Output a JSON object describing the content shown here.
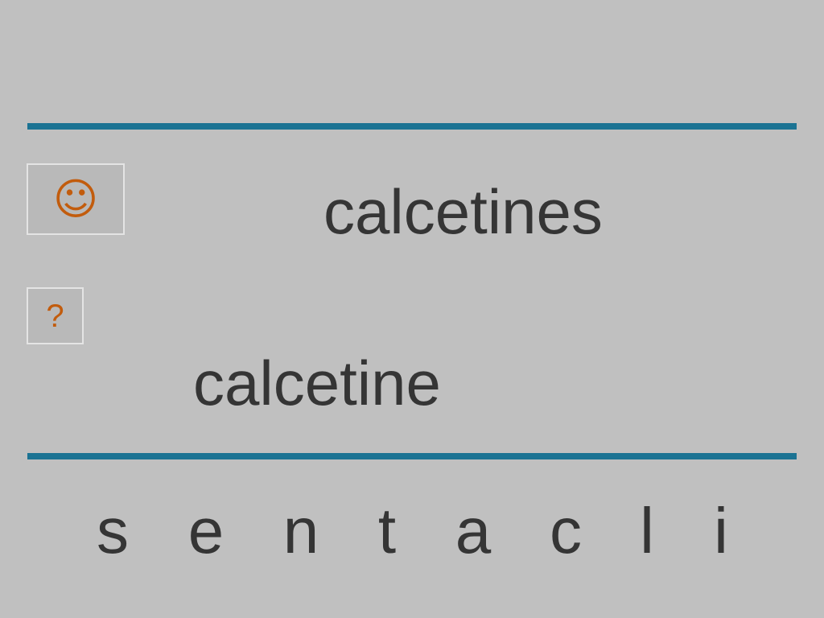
{
  "buttons": {
    "smiley_icon": "☺",
    "hint_label": "?"
  },
  "target_word": "calcetines",
  "answer_word": "calcetine",
  "letters": [
    "s",
    "e",
    "n",
    "t",
    "a",
    "c",
    "l",
    "i"
  ],
  "colors": {
    "background": "#c0c0c0",
    "rule": "#1b7393",
    "text": "#353535",
    "icon": "#c25c0d"
  }
}
